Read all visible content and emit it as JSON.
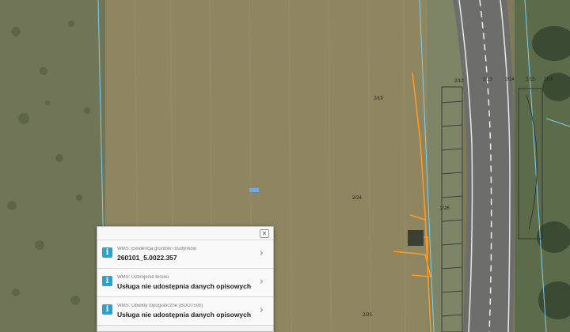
{
  "map": {
    "parcel_labels": [
      "2/19",
      "2/24",
      "2/26",
      "2/23"
    ],
    "road_labels": [
      "2/12",
      "2/13",
      "2/14",
      "2/15",
      "2/16"
    ],
    "colors": {
      "field": "#8d8660",
      "grass": "#6d7454",
      "road": "#6f6f6f",
      "parcel_boundary": "#7fd8ff",
      "highlight": "#ff9a1f"
    }
  },
  "panel": {
    "close_icon": "close-icon",
    "rows": [
      {
        "source": "WMS: Ewidencja gruntów i budynków",
        "value": "260101_5.0022.357"
      },
      {
        "source": "WMS: Uzbrojenie terenu",
        "value": "Usługa nie udostępnia danych opisowych ..."
      },
      {
        "source": "WMS: Obiekty topograficzne (BDOT500)",
        "value": "Usługa nie udostępnia danych opisowych ..."
      }
    ]
  }
}
